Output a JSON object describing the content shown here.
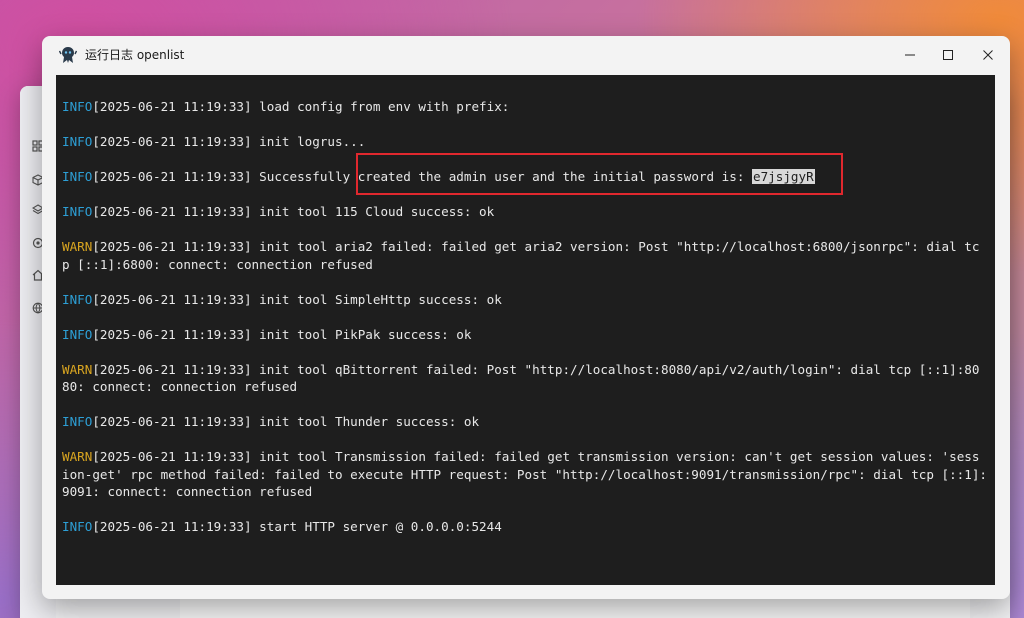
{
  "window": {
    "title": "运行日志 openlist",
    "minimize_label": "",
    "maximize_label": "",
    "close_label": ""
  },
  "background_app": {
    "sidebar_icons": [
      "grid-icon",
      "cube-icon",
      "layers-icon",
      "gear-icon",
      "home-icon",
      "globe-icon"
    ]
  },
  "colors": {
    "info": "#2d9fd6",
    "warn": "#d9a520",
    "console_bg": "#1e1e1e",
    "highlight": "#e0282e"
  },
  "logs": [
    {
      "level": "INFO",
      "timestamp": "[2025-06-21 11:19:33]",
      "message": " load config from env with prefix:"
    },
    {
      "level": "INFO",
      "timestamp": "[2025-06-21 11:19:33]",
      "message": " init logrus..."
    },
    {
      "level": "INFO",
      "timestamp": "[2025-06-21 11:19:33]",
      "message": " Successfully created the admin user and the initial password is: ",
      "password": "e7jsjgyR"
    },
    {
      "level": "INFO",
      "timestamp": "[2025-06-21 11:19:33]",
      "message": " init tool 115 Cloud success: ok"
    },
    {
      "level": "WARN",
      "timestamp": "[2025-06-21 11:19:33]",
      "message": " init tool aria2 failed: failed get aria2 version: Post \"http://localhost:6800/jsonrpc\": dial tcp [::1]:6800: connect: connection refused"
    },
    {
      "level": "INFO",
      "timestamp": "[2025-06-21 11:19:33]",
      "message": " init tool SimpleHttp success: ok"
    },
    {
      "level": "INFO",
      "timestamp": "[2025-06-21 11:19:33]",
      "message": " init tool PikPak success: ok"
    },
    {
      "level": "WARN",
      "timestamp": "[2025-06-21 11:19:33]",
      "message": " init tool qBittorrent failed: Post \"http://localhost:8080/api/v2/auth/login\": dial tcp [::1]:8080: connect: connection refused"
    },
    {
      "level": "INFO",
      "timestamp": "[2025-06-21 11:19:33]",
      "message": " init tool Thunder success: ok"
    },
    {
      "level": "WARN",
      "timestamp": "[2025-06-21 11:19:33]",
      "message": " init tool Transmission failed: failed get transmission version: can't get session values: 'session-get' rpc method failed: failed to execute HTTP request: Post \"http://localhost:9091/transmission/rpc\": dial tcp [::1]:9091: connect: connection refused"
    },
    {
      "level": "INFO",
      "timestamp": "[2025-06-21 11:19:33]",
      "message": " start HTTP server @ 0.0.0.0:5244"
    }
  ]
}
